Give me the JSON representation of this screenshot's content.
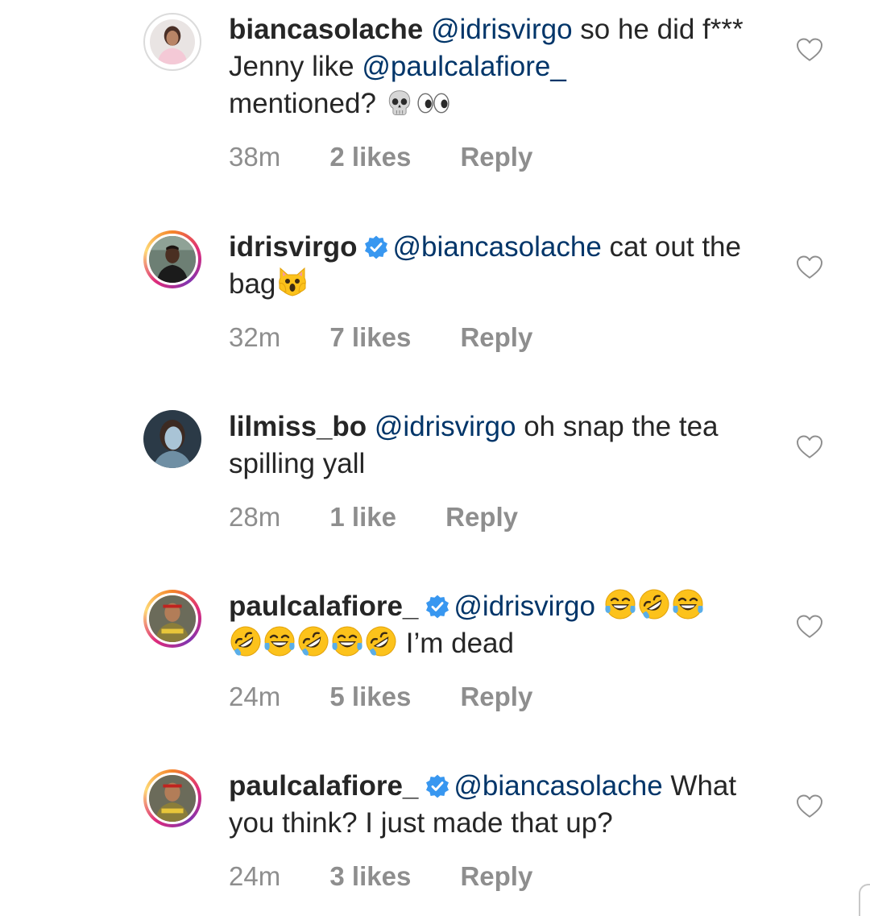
{
  "comments": [
    {
      "username": "biancasolache",
      "verified": false,
      "mention": "@idrisvirgo",
      "text_part1": " so he did f*** Jenny like ",
      "mention2": "@paulcalafiore_",
      "text_part2": " mentioned? ",
      "emoji": [
        "skull-emoji",
        "eyes-emoji"
      ],
      "time": "38m",
      "likes": "2 likes",
      "reply": "Reply"
    },
    {
      "username": "idrisvirgo",
      "verified": true,
      "mention": "@biancasolache",
      "text_part1": " cat out the bag",
      "emoji": [
        "scream-cat-emoji"
      ],
      "time": "32m",
      "likes": "7 likes",
      "reply": "Reply"
    },
    {
      "username": "lilmiss_bo",
      "verified": false,
      "mention": "@idrisvirgo",
      "text_part1": " oh snap the tea spilling yall",
      "time": "28m",
      "likes": "1 like",
      "reply": "Reply"
    },
    {
      "username": "paulcalafiore_",
      "verified": true,
      "mention": "@idrisvirgo",
      "text_part1": " I’m dead",
      "emoji": [
        "joy-emoji",
        "rofl-emoji",
        "joy-emoji",
        "rofl-emoji",
        "joy-emoji",
        "rofl-emoji",
        "joy-emoji",
        "rofl-emoji"
      ],
      "time": "24m",
      "likes": "5 likes",
      "reply": "Reply"
    },
    {
      "username": "paulcalafiore_",
      "verified": true,
      "mention": "@biancasolache",
      "text_part1": " What you think? I just made that up?",
      "time": "24m",
      "likes": "3 likes",
      "reply": "Reply"
    }
  ],
  "colors": {
    "text": "#262626",
    "mention": "#003569",
    "meta": "#8e8e8e",
    "verified": "#3897f0",
    "heart_outline": "#8e8e8e"
  }
}
